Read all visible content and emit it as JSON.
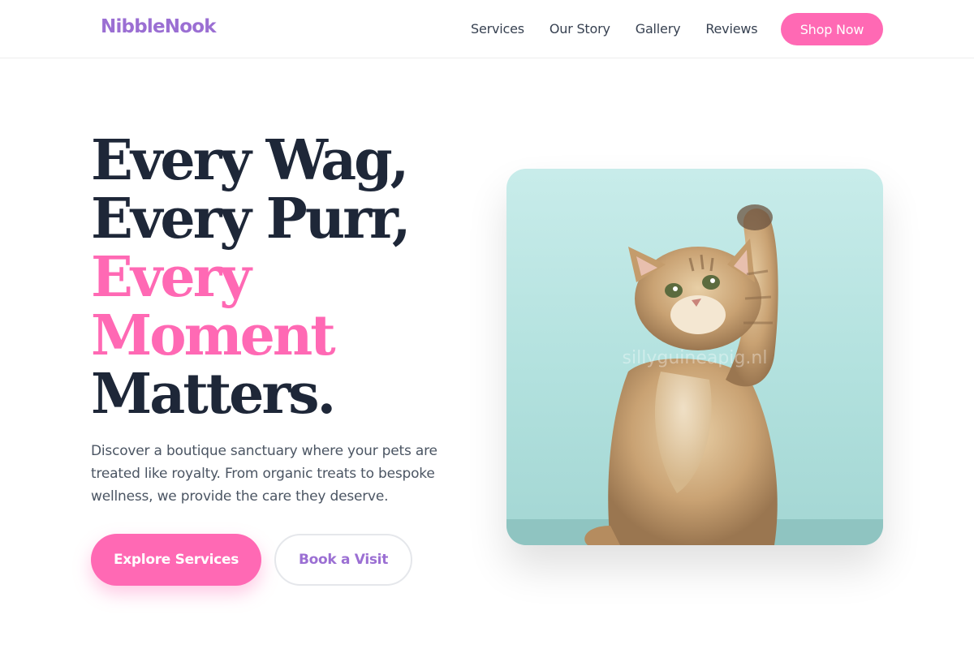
{
  "brand": {
    "name": "NibbleNook",
    "color": "#9b6fd3"
  },
  "nav": {
    "links": [
      "Services",
      "Our Story",
      "Gallery",
      "Reviews"
    ],
    "cta_label": "Shop Now"
  },
  "hero": {
    "headline": {
      "line1": "Every Wag,",
      "line2": "Every Purr,",
      "line3": "Every",
      "line4": "Moment",
      "line5": "Matters."
    },
    "lead": "Discover a boutique sanctuary where your pets are treated like royalty. From organic treats to bespoke wellness, we provide the care they deserve.",
    "primary_cta": "Explore Services",
    "secondary_cta": "Book a Visit",
    "image_watermark": "sillyguineapig.nl",
    "image_subject": "kitten-raising-paw"
  },
  "colors": {
    "accent_pink": "#ff69b4",
    "brand_purple": "#9b6fd3",
    "heading_dark": "#1e2738",
    "image_background": "#c8ecea"
  }
}
